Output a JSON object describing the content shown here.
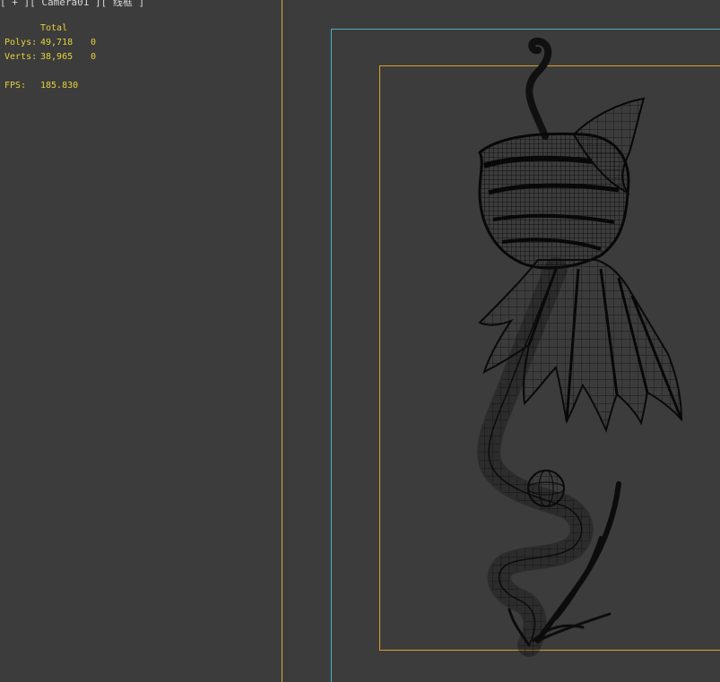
{
  "viewport": {
    "label": "[ + ][ Camera01 ][ 线框 ]",
    "colors": {
      "background": "#3c3c3c",
      "stats_text": "#e6d23a",
      "safe_frame": "#4fb0c6",
      "render_frame": "#d9a02a",
      "divider": "#d6b13a",
      "wireframe": "#111111"
    }
  },
  "stats": {
    "header": "Total",
    "polys_label": "Polys:",
    "polys_value": "49,718",
    "polys_selected": "0",
    "verts_label": "Verts:",
    "verts_value": "38,965",
    "verts_selected": "0",
    "fps_label": "FPS:",
    "fps_value": "185.830"
  },
  "scene": {
    "object": "wireframe-dragon-sculpture"
  }
}
